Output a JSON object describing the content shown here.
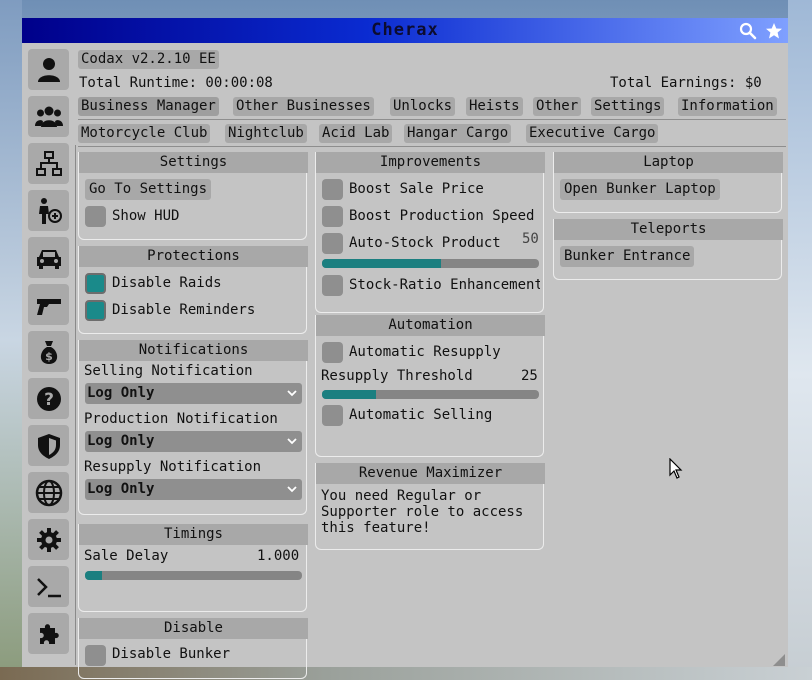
{
  "window": {
    "title": "Cherax"
  },
  "header": {
    "version": "Codax v2.2.10 EE",
    "runtime": "Total Runtime: 00:00:08",
    "earnings": "Total Earnings: $0"
  },
  "tabs_main": [
    {
      "label": "Business Manager",
      "active": true
    },
    {
      "label": "Other Businesses"
    },
    {
      "label": "Unlocks"
    },
    {
      "label": "Heists"
    },
    {
      "label": "Other"
    },
    {
      "label": "Settings"
    },
    {
      "label": "Information"
    }
  ],
  "tabs_sub": [
    {
      "label": "Motorcycle Club"
    },
    {
      "label": "Nightclub"
    },
    {
      "label": "Acid Lab"
    },
    {
      "label": "Hangar Cargo"
    },
    {
      "label": "Executive Cargo"
    }
  ],
  "sidebar": {
    "icons": [
      "user-icon",
      "group-icon",
      "network-icon",
      "person-add-icon",
      "car-icon",
      "gun-icon",
      "money-bag-icon",
      "help-icon",
      "shield-icon",
      "globe-icon",
      "gear-icon",
      "terminal-icon",
      "puzzle-icon"
    ]
  },
  "settings_panel": {
    "title": "Settings",
    "go_to_settings": "Go To Settings",
    "show_hud": "Show HUD"
  },
  "protections": {
    "title": "Protections",
    "disable_raids": "Disable Raids",
    "disable_reminders": "Disable Reminders"
  },
  "notifications": {
    "title": "Notifications",
    "selling_label": "Selling Notification",
    "selling_value": "Log Only",
    "production_label": "Production Notification",
    "production_value": "Log Only",
    "resupply_label": "Resupply Notification",
    "resupply_value": "Log Only"
  },
  "timings": {
    "title": "Timings",
    "sale_delay_label": "Sale Delay",
    "sale_delay_value": "1.000",
    "sale_delay_fraction": 0.08
  },
  "disable": {
    "title": "Disable",
    "disable_bunker": "Disable Bunker"
  },
  "improvements": {
    "title": "Improvements",
    "boost_sale_price": "Boost Sale Price",
    "boost_production": "Boost Production Speed",
    "auto_stock": "Auto-Stock Product",
    "auto_stock_value": "50",
    "auto_stock_fraction": 0.55,
    "stock_ratio": "Stock-Ratio Enhancement"
  },
  "automation": {
    "title": "Automation",
    "auto_resupply": "Automatic Resupply",
    "threshold_label": "Resupply Threshold",
    "threshold_value": "25",
    "threshold_fraction": 0.25,
    "auto_selling": "Automatic Selling"
  },
  "revenue": {
    "title": "Revenue Maximizer",
    "message_l1": "You need Regular or",
    "message_l2": "Supporter role to access",
    "message_l3": "this feature!"
  },
  "laptop": {
    "title": "Laptop",
    "open_laptop": "Open Bunker Laptop"
  },
  "teleports": {
    "title": "Teleports",
    "bunker_entrance": "Bunker Entrance"
  },
  "colors": {
    "accent": "#1b7f80",
    "titlebar": "#0a2bd1",
    "panel": "#c4c4c4",
    "control": "#a8a8a8"
  }
}
